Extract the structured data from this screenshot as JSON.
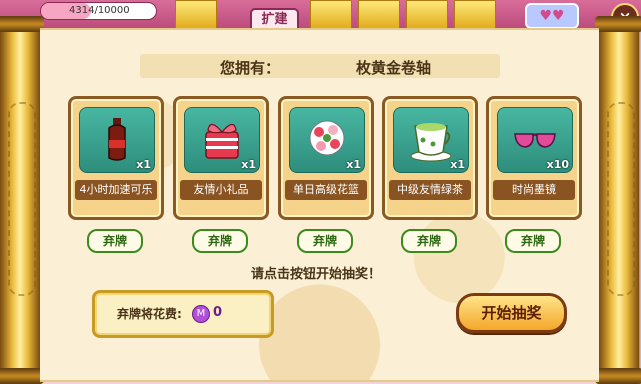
{
  "topbar": {
    "exp_text": "4314/10000",
    "exp_fraction": 0.4314,
    "build_tab_label": "扩建"
  },
  "owned": {
    "label": "您拥有：",
    "value": "枚黄金卷轴"
  },
  "cards": [
    {
      "name": "4小时加速可乐",
      "qty": "x1",
      "icon": "cola-bottle-icon"
    },
    {
      "name": "友情小礼品",
      "qty": "x1",
      "icon": "gift-box-icon"
    },
    {
      "name": "单日高级花篮",
      "qty": "x1",
      "icon": "flower-basket-icon"
    },
    {
      "name": "中级友情绿茶",
      "qty": "x1",
      "icon": "green-tea-cup-icon"
    },
    {
      "name": "时尚墨镜",
      "qty": "x10",
      "icon": "sunglasses-icon"
    }
  ],
  "discard_label": "弃牌",
  "hint": "请点击按钮开始抽奖！",
  "cost": {
    "label": "弃牌将花费:",
    "currency_symbol": "M",
    "value": "0"
  },
  "start_button": "开始抽奖",
  "colors": {
    "card_bg": "#f5d38b",
    "card_border": "#8a5a22",
    "slot_teal": "#2e8e7c",
    "button_green": "#3b8a1c",
    "start_orange": "#f3a72a"
  }
}
